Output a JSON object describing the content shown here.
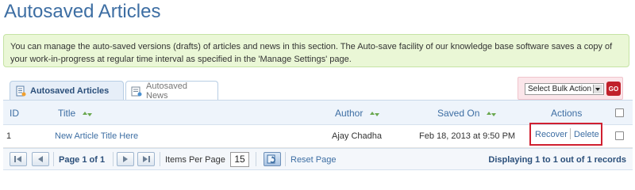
{
  "page": {
    "title": "Autosaved Articles",
    "info": "You can manage the auto-saved versions (drafts) of articles and news in this section. The Auto-save facility of our knowledge base software saves a copy of your work-in-progress at regular time interval as specified in the 'Manage Settings' page."
  },
  "tabs": [
    {
      "label": "Autosaved Articles",
      "active": true,
      "icon": "article-icon"
    },
    {
      "label": "Autosaved News",
      "active": false,
      "icon": "news-icon"
    }
  ],
  "bulk": {
    "selected": "Select Bulk Action",
    "go_label": "GO"
  },
  "grid": {
    "columns": {
      "id": "ID",
      "title": "Title",
      "author": "Author",
      "saved_on": "Saved On",
      "actions": "Actions"
    },
    "rows": [
      {
        "id": "1",
        "title": "New Article Title Here",
        "author": "Ajay Chadha",
        "saved_on": "Feb 18, 2013 at 9:50 PM",
        "recover": "Recover",
        "delete": "Delete"
      }
    ]
  },
  "pager": {
    "page_info": "Page 1 of 1",
    "items_per_page_label": "Items Per Page",
    "items_per_page": "15",
    "reset": "Reset Page",
    "display": "Displaying 1 to 1 out of 1 records"
  },
  "colors": {
    "accent": "#3d6ea3",
    "highlight": "#d02030",
    "info_bg": "#eaf7d6"
  }
}
